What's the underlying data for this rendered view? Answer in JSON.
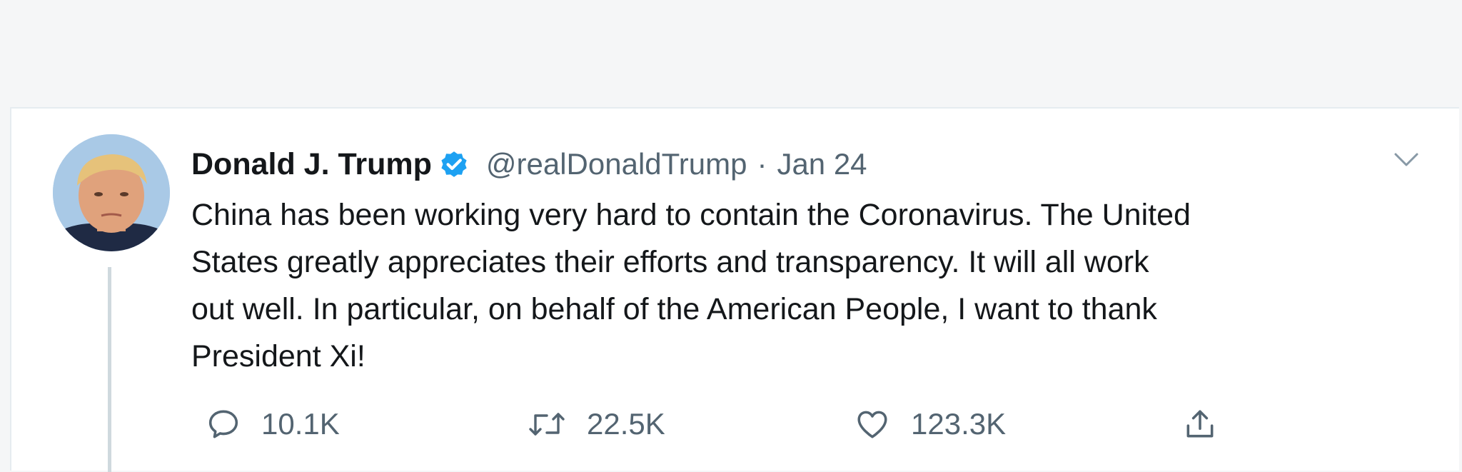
{
  "tweet": {
    "author": {
      "display_name": "Donald J. Trump",
      "handle": "@realDonaldTrump",
      "verified": true
    },
    "separator": "·",
    "timestamp": "Jan 24",
    "text": "China has been working very hard to contain the Coronavirus. The United\nStates greatly appreciates their efforts and transparency. It will all work\nout well. In particular, on behalf of the American People, I want to thank\nPresident Xi!",
    "stats": {
      "replies": "10.1K",
      "retweets": "22.5K",
      "likes": "123.3K"
    }
  },
  "icons": {
    "verified": "verified-badge-icon",
    "menu": "chevron-down-icon",
    "reply": "reply-bubble-icon",
    "retweet": "retweet-icon",
    "like": "heart-icon",
    "share": "share-icon"
  },
  "colors": {
    "verified_blue": "#1da1f2",
    "text_primary": "#14171a",
    "text_secondary": "#536471",
    "page_background": "#f5f6f7"
  }
}
